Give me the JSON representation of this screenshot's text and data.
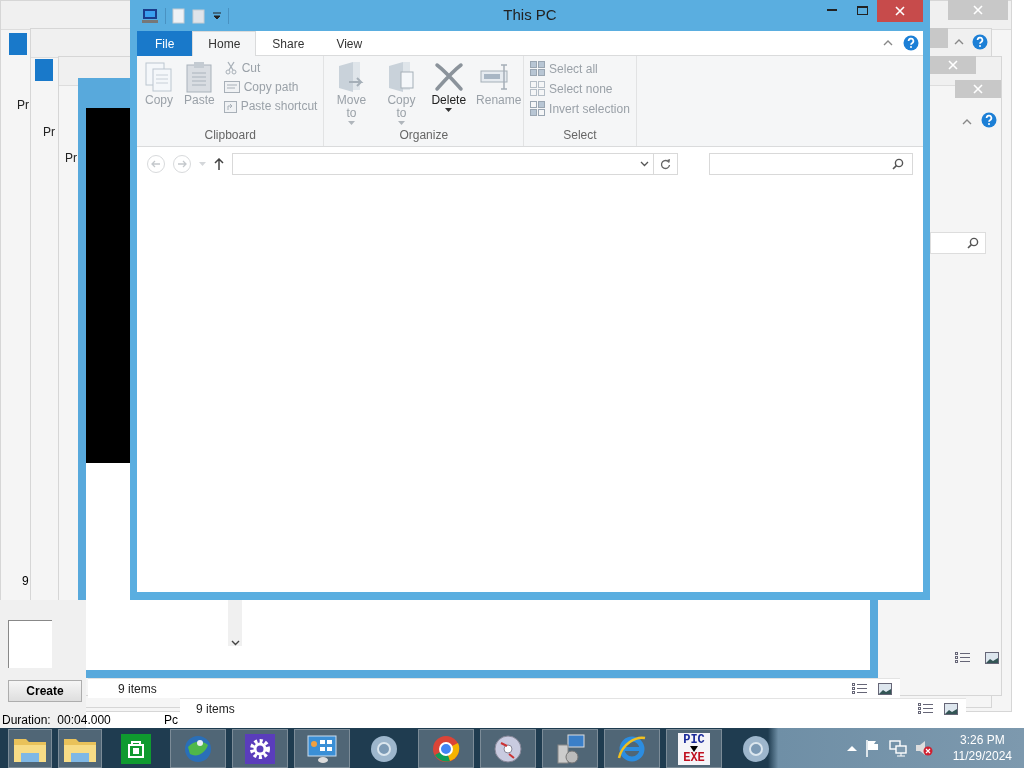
{
  "background_windows": [
    {
      "label": "Pr",
      "status": "9 items"
    },
    {
      "label": "Pr",
      "status": "9 items"
    },
    {
      "label": "Pr"
    }
  ],
  "back_panel": {
    "count": "9",
    "button": "Create",
    "duration": "Duration:  00:04.000",
    "column_2": "Pc"
  },
  "window": {
    "title": "This PC"
  },
  "ribbon": {
    "tabs": [
      {
        "label": "File",
        "kind": "file",
        "selected": false
      },
      {
        "label": "Home",
        "kind": "tab",
        "selected": true
      },
      {
        "label": "Share",
        "kind": "tab",
        "selected": false
      },
      {
        "label": "View",
        "kind": "tab",
        "selected": false
      }
    ],
    "groups": [
      {
        "name": "Clipboard",
        "commands": [
          {
            "label": "Copy",
            "kind": "large",
            "disabled": true,
            "menu": false
          },
          {
            "label": "Paste",
            "kind": "large",
            "disabled": true,
            "menu": false
          },
          {
            "label": "Cut",
            "kind": "small",
            "disabled": true,
            "menu": false
          },
          {
            "label": "Copy path",
            "kind": "small",
            "disabled": true,
            "menu": false
          },
          {
            "label": "Paste shortcut",
            "kind": "small",
            "disabled": true,
            "menu": false
          }
        ]
      },
      {
        "name": "Organize",
        "commands": [
          {
            "label": "Move to",
            "kind": "large",
            "disabled": true,
            "menu": true
          },
          {
            "label": "Copy to",
            "kind": "large",
            "disabled": true,
            "menu": true
          },
          {
            "label": "Delete",
            "kind": "large",
            "disabled": false,
            "menu": true
          },
          {
            "label": "Rename",
            "kind": "large",
            "disabled": true,
            "menu": false
          }
        ]
      },
      {
        "name": "Select",
        "commands": [
          {
            "label": "Select all",
            "kind": "small",
            "disabled": true,
            "menu": false
          },
          {
            "label": "Select none",
            "kind": "small",
            "disabled": true,
            "menu": false
          },
          {
            "label": "Invert selection",
            "kind": "small",
            "disabled": true,
            "menu": false
          }
        ]
      }
    ]
  },
  "taskbar": {
    "apps": [
      {
        "kind": "folder",
        "running": true
      },
      {
        "kind": "folder",
        "running": true
      },
      {
        "kind": "store",
        "running": false
      },
      {
        "kind": "globe",
        "running": true
      },
      {
        "kind": "gear",
        "running": true
      },
      {
        "kind": "panel",
        "running": true
      },
      {
        "kind": "chrome-gray",
        "running": false
      },
      {
        "kind": "chrome",
        "running": true
      },
      {
        "kind": "disc",
        "running": true
      },
      {
        "kind": "installer",
        "running": true
      },
      {
        "kind": "ie",
        "running": true
      },
      {
        "kind": "picexe",
        "running": true,
        "lines": [
          "PIC",
          "EXE"
        ]
      },
      {
        "kind": "chrome-gray",
        "running": false
      }
    ],
    "clock": {
      "time": "3:26 PM",
      "date": "11/29/2024"
    }
  }
}
